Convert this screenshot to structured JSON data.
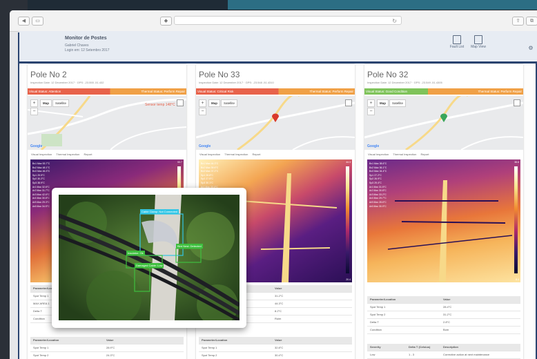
{
  "header": {
    "title": "Monitor de Postes",
    "line1": "Gabriel Chaves",
    "line2": "Login em: 12 Setembro 2017",
    "icons": [
      {
        "icon": "report-icon",
        "label": "Fault List"
      },
      {
        "icon": "map-icon",
        "label": "Map View"
      },
      {
        "icon": "gear-icon",
        "label": "Settings"
      }
    ]
  },
  "colors": {
    "accent": "#2a4470",
    "red": "#e8624a",
    "orange": "#f0a046",
    "green": "#7fc35a"
  },
  "map_labels": {
    "map": "Map",
    "satellite": "Satellite",
    "google": "Google"
  },
  "view_tabs": [
    "Visual Inspection",
    "Thermal Inspection",
    "Report"
  ],
  "cards": [
    {
      "title": "Pole No 2",
      "sub": "Inspection Date: 12 December 2017 · GPS: -23.555 -51.432",
      "band_left": "Visual Status: Attention",
      "band_right": "Thermal Status: Perform Repair",
      "band_colors": [
        "#e8624a",
        "#f0a046"
      ],
      "temp_callout": "Sensor temp 148°C",
      "readings": [
        "Bx1 Max 53.7°C",
        "Bx2 Max 48.1°C",
        "Bx3 Max 46.3°C",
        "Sp1 29.5°C",
        "Sp2 30.2°C",
        "Sp3 38.9°C",
        "Ar1 Max 32.6°C",
        "Ar2 Max 31.7°C",
        "Ar3 Max 42.6°C",
        "Ar4 Max 30.8°C",
        "Ar5 Max 29.3°C",
        "Ar6 Max 34.5°C"
      ],
      "scale_top": "53.7",
      "scale_bottom": "21.9",
      "table1": [
        [
          "Parameter/Location",
          "Value",
          "Description"
        ],
        [
          "Spot Temp 1",
          "27.4°C",
          ""
        ],
        [
          "MAX AREA 1",
          "53.7°C",
          ""
        ],
        [
          "Delta T",
          "6.2°C",
          ""
        ],
        [
          "Condition",
          "Ruim",
          ""
        ]
      ],
      "table2": [
        [
          "Parameter/Location",
          "Value",
          ""
        ],
        [
          "Spot Temp 1",
          "28.9°C",
          ""
        ],
        [
          "Spot Temp 2",
          "24.3°C",
          ""
        ]
      ]
    },
    {
      "title": "Pole No 33",
      "sub": "Inspection Date: 12 December 2017 · GPS: -23.548 -51.4310",
      "band_left": "Visual Status: Critical Risk",
      "band_right": "Thermal Status: Perform Repair",
      "band_colors": [
        "#e8624a",
        "#f0a046"
      ],
      "temp_callout": "",
      "readings": [
        "Bx1 Max 44.3°C",
        "Bx2 Max 39.6°C",
        "Bx3 Max 37.2°C",
        "Sp1 28.8°C",
        "Sp2 27.5°C",
        "Sp3 30.1°C",
        "Ar1 Max 33.0°C",
        "Ar2 Max 31.4°C",
        "Ar3 Max 35.9°C",
        "Ar4 Max 30.2°C",
        "Ar5 Max 29.6°C",
        "Ar6 Max 32.7°C"
      ],
      "scale_top": "44.3",
      "scale_bottom": "20.4",
      "table1": [
        [
          "Parameter/Location",
          "Value",
          "Description"
        ],
        [
          "Spot Temp 1",
          "31.2°C",
          ""
        ],
        [
          "MAX AREA 1",
          "44.3°C",
          ""
        ],
        [
          "Delta T",
          "8.2°C",
          ""
        ],
        [
          "Condition",
          "Ruim",
          ""
        ]
      ],
      "table2": [
        [
          "Parameter/Location",
          "Value",
          ""
        ],
        [
          "Spot Temp 1",
          "32.8°C",
          ""
        ],
        [
          "Spot Temp 2",
          "30.4°C",
          ""
        ]
      ]
    },
    {
      "title": "Pole No 32",
      "sub": "Inspection Date: 12 December 2017 · GPS: -23.549 -51.4305",
      "band_left": "Visual Status: Good Condition",
      "band_right": "Thermal Status: Perform Repair",
      "band_colors": [
        "#7fc35a",
        "#f0a046"
      ],
      "temp_callout": "",
      "readings": [
        "Bx1 Max 38.6°C",
        "Bx2 Max 36.1°C",
        "Bx3 Max 34.4°C",
        "Sp1 27.2°C",
        "Sp2 26.9°C",
        "Sp3 29.4°C",
        "Ar1 Max 31.5°C",
        "Ar2 Max 30.8°C",
        "Ar3 Max 33.2°C",
        "Ar4 Max 29.7°C",
        "Ar5 Max 28.6°C",
        "Ar6 Max 30.9°C"
      ],
      "scale_top": "38.6",
      "scale_bottom": "8.4",
      "table1": [
        [
          "Parameter/Location",
          "Value",
          ""
        ],
        [
          "Spot Temp 1",
          "28.4°C",
          ""
        ],
        [
          "Spot Temp 2",
          "31.2°C",
          ""
        ],
        [
          "Delta T",
          "2.8°C",
          ""
        ],
        [
          "Condition",
          "Bom",
          ""
        ]
      ],
      "table2": [
        [
          "Severity",
          "Delta T (Celsius)",
          "Description"
        ],
        [
          "Low",
          "1 - 3",
          "Corrective action at next maintenance"
        ]
      ]
    }
  ],
  "detections": [
    {
      "label": "Cable Clamp: Not Connected",
      "color": "#33c6e6"
    },
    {
      "label": "Insulator: Ok",
      "color": "#3fbf3f"
    },
    {
      "label": "Bird Nest: Detected",
      "color": "#3fbf3f"
    },
    {
      "label": "Damaged Cable: Low",
      "color": "#3fbf3f"
    }
  ]
}
